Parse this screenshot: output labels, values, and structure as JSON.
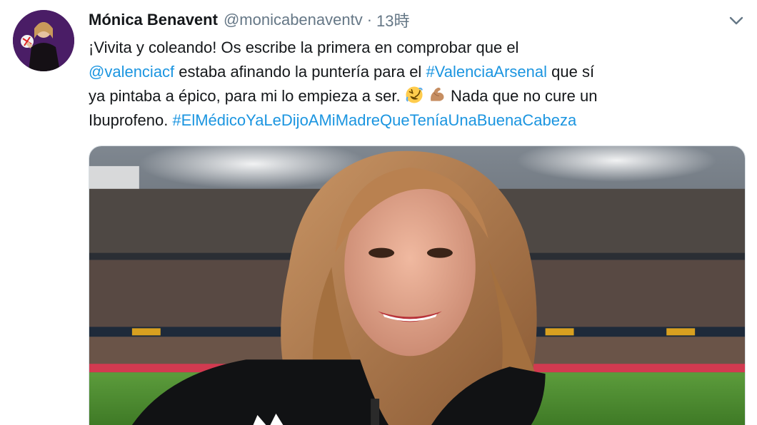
{
  "tweet": {
    "display_name": "Mónica Benavent",
    "handle": "@monicabenaventv",
    "separator": "·",
    "time": "13時",
    "text": {
      "line1": "¡Vivita y coleando! Os escribe la primera en comprobar que el",
      "line2_mention": "@valenciacf",
      "line2_mid": " estaba afinando la puntería para el ",
      "line2_hashtag": "#ValenciaArsenal",
      "line2_end": " que sí",
      "line3_text": "ya pintaba a épico, para mi lo empieza a ser. ",
      "line3_end": " Nada que no cure un",
      "line4_text": "Ibuprofeno. ",
      "line4_hashtag": "#ElMédicoYaLeDijoAMiMadreQueTeníaUnaBuenaCabeza"
    },
    "emojis": [
      "rolling-on-floor-laughing-icon",
      "flexed-biceps-icon"
    ],
    "media_alt": "photo-stadium-selfie"
  },
  "colors": {
    "link": "#1b95e0",
    "secondary_text": "#657786",
    "primary_text": "#14171a"
  }
}
